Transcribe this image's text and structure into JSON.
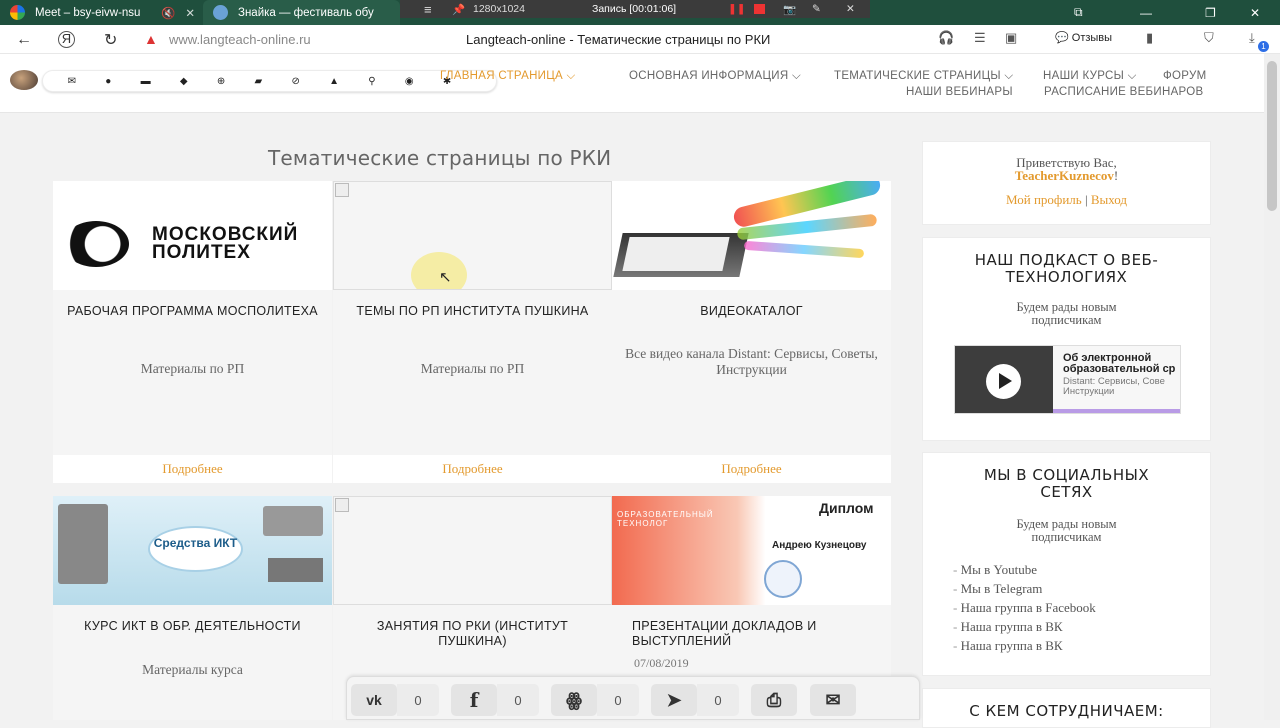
{
  "browser": {
    "tabs": [
      {
        "label": "Meet – bsy-eivw-nsu",
        "active": false
      },
      {
        "label": "Знайка — фестиваль обу",
        "active": true
      }
    ],
    "recorder": {
      "resolution": "1280x1024",
      "status": "Запись [00:01:06]"
    },
    "address": {
      "url": "www.langteach-online.ru",
      "page_title": "Langteach-online - Тематические страницы по РКИ"
    },
    "feedback_label": "Отзывы",
    "downloads_badge": "1"
  },
  "site": {
    "nav": {
      "row1": [
        {
          "label": "ГЛАВНАЯ СТРАНИЦА ⌵",
          "active": true
        },
        {
          "label": "ОСНОВНАЯ ИНФОРМАЦИЯ ⌵",
          "active": false
        },
        {
          "label": "ТЕМАТИЧЕСКИЕ СТРАНИЦЫ ⌵",
          "active": false
        },
        {
          "label": "НАШИ КУРСЫ ⌵",
          "active": false
        },
        {
          "label": "ФОРУМ",
          "active": false
        }
      ],
      "row2": [
        {
          "label": "НАШИ ВЕБИНАРЫ"
        },
        {
          "label": "РАСПИСАНИЕ ВЕБИНАРОВ"
        }
      ]
    },
    "page_heading": "Тематические страницы по РКИ",
    "cards": [
      {
        "thumb": "mospolytech-logo",
        "logo_text_1": "МОСКОВСКИЙ",
        "logo_text_2": "ПОЛИТЕХ",
        "title": "РАБОЧАЯ ПРОГРАММА МОСПОЛИТЕХА",
        "desc": "Материалы по РП",
        "more": "Подробнее"
      },
      {
        "thumb": "broken-image",
        "title": "ТЕМЫ ПО РП ИНСТИТУТА ПУШКИНА",
        "desc": "Материалы по РП",
        "more": "Подробнее"
      },
      {
        "thumb": "laptop-illustration",
        "title": "ВИДЕОКАТАЛОГ",
        "desc": "Все видео канала Distant: Сервисы, Советы, Инструкции",
        "more": "Подробнее"
      },
      {
        "thumb": "ict-collage",
        "thumb_text": "Средства ИКТ",
        "title": "КУРС ИКТ В ОБР. ДЕЯТЕЛЬНОСТИ",
        "desc": "Материалы курса"
      },
      {
        "thumb": "broken-image",
        "title": "ЗАНЯТИЯ ПО РКИ (ИНСТИТУТ ПУШКИНА)"
      },
      {
        "thumb": "diploma",
        "thumb_text_1": "Диплом",
        "thumb_text_2": "Андрею Кузнецову",
        "thumb_text_3": "ОБРАЗОВАТЕЛЬНЫЙ ТЕХНОЛОГ",
        "title": "ПРЕЗЕНТАЦИИ ДОКЛАДОВ И ВЫСТУПЛЕНИЙ",
        "date": "07/08/2019"
      }
    ],
    "sidebar": {
      "greeting": "Приветствую Вас,",
      "username": "TeacherKuznecov",
      "profile_link": "Мой профиль",
      "logout_link": "Выход",
      "podcast": {
        "title": "НАШ ПОДКАСТ О ВЕБ-ТЕХНОЛОГИЯХ",
        "subtitle": "Будем рады новым подписчикам",
        "episode_title": "Об электронной образовательной ср",
        "episode_sub": "Distant: Сервисы, Сове Инструкции"
      },
      "social": {
        "title": "МЫ В СОЦИАЛЬНЫХ СЕТЯХ",
        "subtitle": "Будем рады новым подписчикам",
        "links": [
          "Мы в Youtube",
          "Мы в Telegram",
          "Наша группа в Facebook",
          "Наша группа в ВК",
          "Наша группа в ВК"
        ]
      },
      "partners_title": "С КЕМ СОТРУДНИЧАЕМ:"
    },
    "share": {
      "vk": {
        "icon": "vk-icon",
        "count": "0"
      },
      "facebook": {
        "icon": "facebook-icon",
        "count": "0"
      },
      "odnoklassniki": {
        "icon": "odnoklassniki-icon",
        "count": "0"
      },
      "telegram": {
        "icon": "telegram-icon",
        "count": "0"
      },
      "print": {
        "icon": "print-icon"
      },
      "email": {
        "icon": "mail-icon"
      }
    }
  },
  "colors": {
    "accent": "#e39a2e",
    "tabbar": "#1f4f3d"
  }
}
